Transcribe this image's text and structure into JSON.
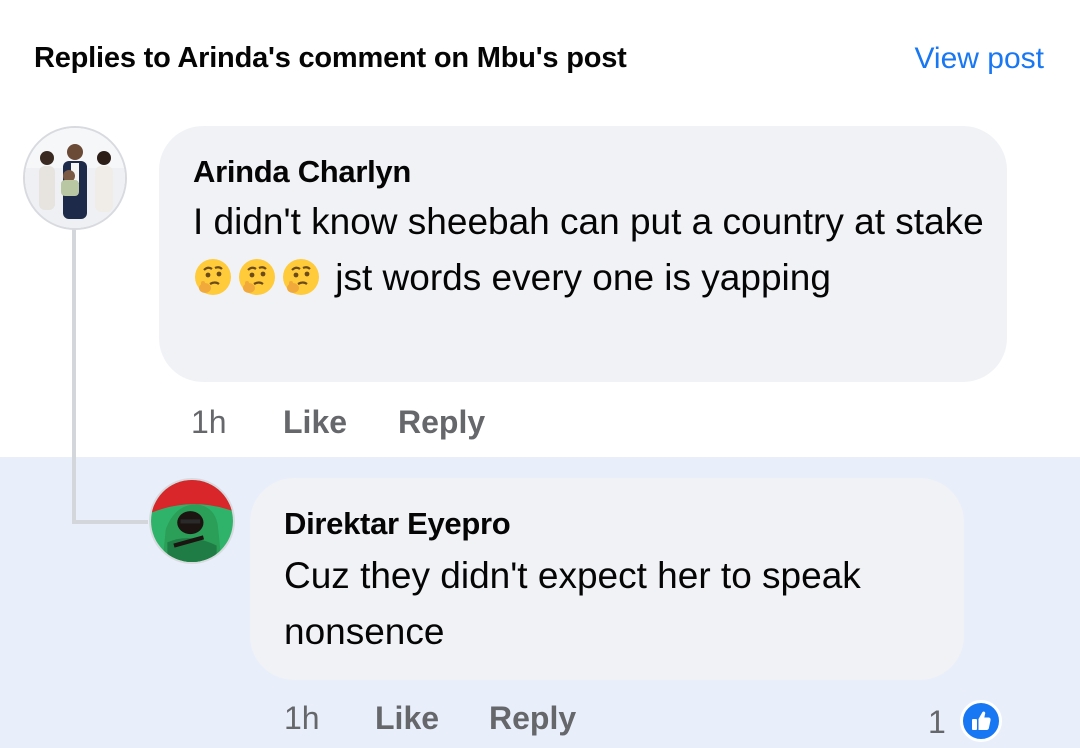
{
  "header": {
    "title": "Replies to Arinda's comment on Mbu's post",
    "view_post_label": "View post"
  },
  "comments": [
    {
      "author": "Arinda Charlyn",
      "text_before": "I didn't know sheebah can put a country at stake ",
      "emojis": [
        "thinking-face",
        "thinking-face",
        "thinking-face"
      ],
      "text_after": " jst words every one is yapping",
      "time": "1h",
      "like_label": "Like",
      "reply_label": "Reply"
    },
    {
      "author": "Direktar Eyepro",
      "text": "Cuz they didn't expect her to speak nonsence",
      "time": "1h",
      "like_label": "Like",
      "reply_label": "Reply",
      "reaction_count": "1",
      "reaction_icon": "like-thumb-icon"
    }
  ],
  "colors": {
    "accent": "#1877f2",
    "bubble": "#f0f2f5",
    "highlight_row": "#e8eefa",
    "muted_text": "#65676b"
  }
}
